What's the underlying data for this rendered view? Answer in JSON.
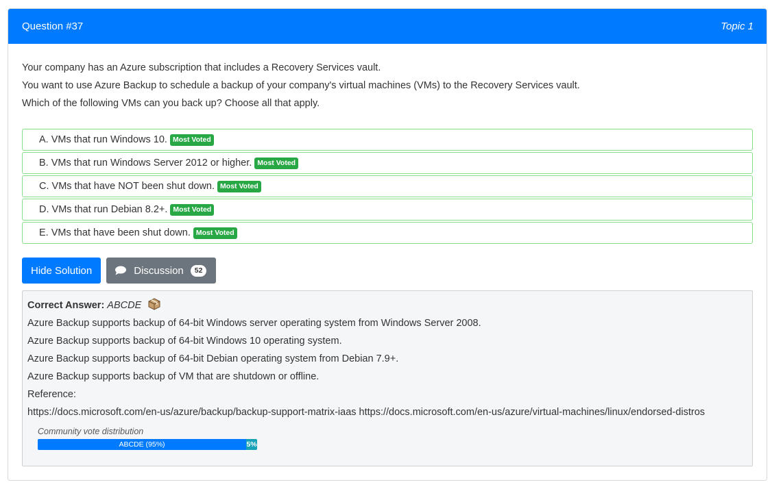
{
  "header": {
    "question": "Question #37",
    "topic": "Topic 1"
  },
  "question_lines": [
    "Your company has an Azure subscription that includes a Recovery Services vault.",
    "You want to use Azure Backup to schedule a backup of your company's virtual machines (VMs) to the Recovery Services vault.",
    "Which of the following VMs can you back up? Choose all that apply."
  ],
  "choices": [
    {
      "text": "A. VMs that run Windows 10.",
      "badge": "Most Voted"
    },
    {
      "text": "B. VMs that run Windows Server 2012 or higher.",
      "badge": "Most Voted"
    },
    {
      "text": "C. VMs that have NOT been shut down.",
      "badge": "Most Voted"
    },
    {
      "text": "D. VMs that run Debian 8.2+.",
      "badge": "Most Voted"
    },
    {
      "text": "E. VMs that have been shut down.",
      "badge": "Most Voted"
    }
  ],
  "buttons": {
    "hide_solution": "Hide Solution",
    "discussion": "Discussion",
    "discussion_count": "52"
  },
  "answer": {
    "label": "Correct Answer:",
    "value": "ABCDE",
    "lines": [
      "Azure Backup supports backup of 64-bit Windows server operating system from Windows Server 2008.",
      "Azure Backup supports backup of 64-bit Windows 10 operating system.",
      "Azure Backup supports backup of 64-bit Debian operating system from Debian 7.9+.",
      "Azure Backup supports backup of VM that are shutdown or offline.",
      "Reference:",
      "https://docs.microsoft.com/en-us/azure/backup/backup-support-matrix-iaas https://docs.microsoft.com/en-us/azure/virtual-machines/linux/endorsed-distros"
    ]
  },
  "vote": {
    "title": "Community vote distribution",
    "segments": [
      {
        "label": "ABCDE (95%)",
        "percent": 95
      },
      {
        "label": "5%",
        "percent": 5
      }
    ]
  },
  "colors": {
    "primary": "#007bff",
    "success": "#28a745",
    "secondary": "#6c757d",
    "info": "#17a2b8",
    "choice_border": "#86e08a"
  },
  "icons": {
    "discussion": "speech-bubble-icon",
    "answer": "box-icon"
  }
}
